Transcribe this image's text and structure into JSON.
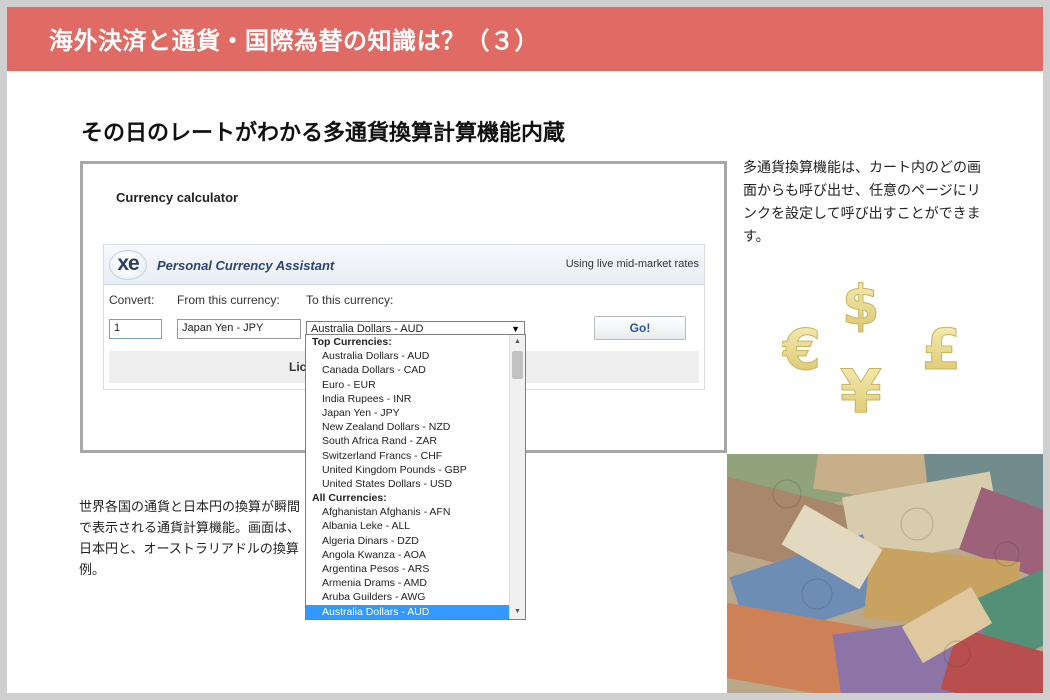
{
  "banner": {
    "title": "海外決済と通貨・国際為替の知識は？（３）"
  },
  "headline": "その日のレートがわかる多通貨換算計算機能内蔵",
  "calculator": {
    "title": "Currency calculator",
    "brand": "Personal Currency Assistant",
    "rates_note": "Using live mid-market rates",
    "convert_label": "Convert:",
    "from_label": "From this currency:",
    "to_label": "To this currency:",
    "amount_value": "1",
    "from_value": "Japan Yen - JPY",
    "to_value": "Australia Dollars - AUD",
    "go_label": "Go!",
    "lic_text": "Lic"
  },
  "dropdown": {
    "top_group": "Top Currencies:",
    "top_items": [
      "Australia Dollars - AUD",
      "Canada Dollars - CAD",
      "Euro - EUR",
      "India Rupees - INR",
      "Japan Yen - JPY",
      "New Zealand Dollars - NZD",
      "South Africa Rand - ZAR",
      "Switzerland Francs - CHF",
      "United Kingdom Pounds - GBP",
      "United States Dollars - USD"
    ],
    "all_group": "All Currencies:",
    "all_items": [
      "Afghanistan Afghanis - AFN",
      "Albania Leke - ALL",
      "Algeria Dinars - DZD",
      "Angola Kwanza - AOA",
      "Argentina Pesos - ARS",
      "Armenia Drams - AMD",
      "Aruba Guilders - AWG",
      "Australia Dollars - AUD"
    ],
    "selected": "Australia Dollars - AUD"
  },
  "side_text": "多通貨換算機能は、カート内のどの画面からも呼び出せ、任意のページにリンクを設定して呼び出すことができます。",
  "caption": "世界各国の通貨と日本円の換算が瞬間で表示される通貨計算機能。画面は、日本円と、オーストラリアドルの換算例。",
  "currency_symbols": {
    "dollar": "$",
    "euro": "€",
    "pound": "£",
    "yen": "¥"
  },
  "colors": {
    "banner": "#e06a64",
    "select_highlight": "#3399ff",
    "brand_text": "#2d4373",
    "gold": "#e9d98a"
  },
  "icons": {
    "logo": "xe-logo-icon",
    "dropdown_arrow": "triangle-down-icon"
  }
}
